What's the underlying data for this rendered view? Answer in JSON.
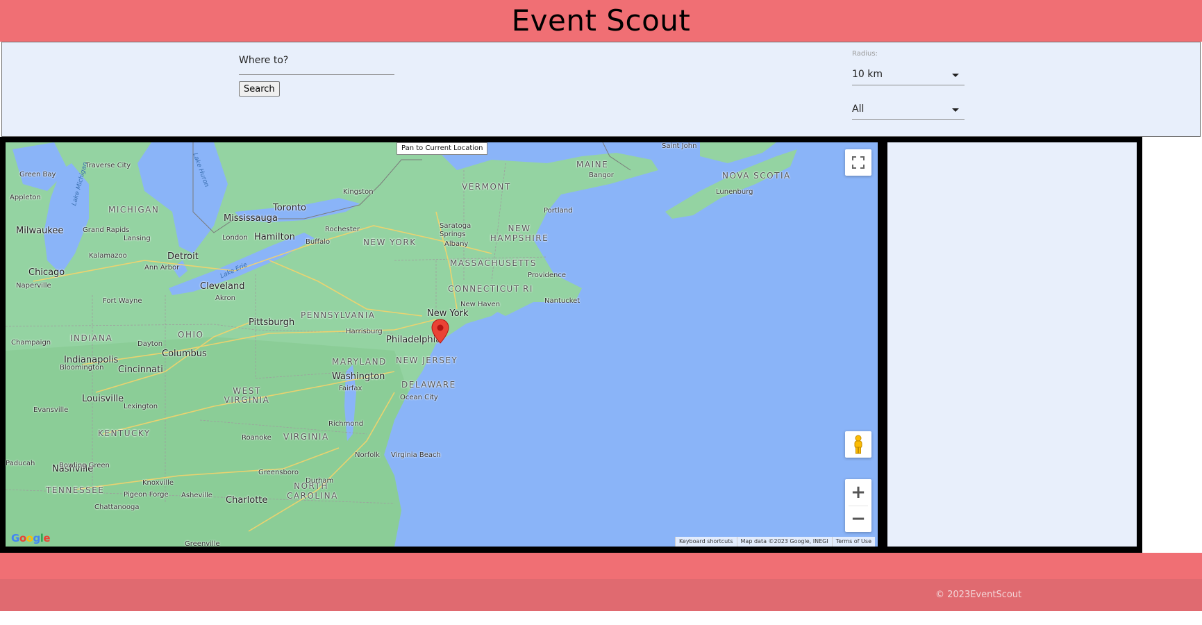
{
  "header": {
    "title": "Event Scout"
  },
  "search": {
    "where_label": "Where to?",
    "search_button": "Search",
    "radius_caption": "Radius:",
    "radius_value": "10 km",
    "category_value": "All"
  },
  "map": {
    "pan_button": "Pan to Current Location",
    "attribution": {
      "shortcuts": "Keyboard shortcuts",
      "data": "Map data ©2023 Google, INEGI",
      "terms": "Terms of Use"
    },
    "google_logo": "Google",
    "states": [
      "MICHIGAN",
      "VERMONT",
      "MAINE",
      "NOVA SCOTIA",
      "NEW HAMPSHIRE",
      "NEW YORK",
      "MASSACHUSETTS",
      "CONNECTICUT",
      "RI",
      "PENNSYLVANIA",
      "INDIANA",
      "OHIO",
      "NEW JERSEY",
      "MARYLAND",
      "DELAWARE",
      "WEST VIRGINIA",
      "VIRGINIA",
      "KENTUCKY",
      "TENNESSEE",
      "NORTH CAROLINA"
    ],
    "cities_major": [
      "Toronto",
      "Mississauga",
      "Hamilton",
      "Detroit",
      "Cleveland",
      "Chicago",
      "Milwaukee",
      "Pittsburgh",
      "Philadelphia",
      "New York",
      "Columbus",
      "Cincinnati",
      "Indianapolis",
      "Louisville",
      "Washington",
      "Nashville",
      "Charlotte"
    ],
    "cities_minor": [
      "Green Bay",
      "Traverse City",
      "Appleton",
      "Grand Rapids",
      "Lansing",
      "Kalamazoo",
      "Ann Arbor",
      "Naperville",
      "Fort Wayne",
      "Champaign",
      "Dayton",
      "Bloomington",
      "Evansville",
      "Lexington",
      "Paducah",
      "Bowling Green",
      "Knoxville",
      "Pigeon Forge",
      "Asheville",
      "Chattanooga",
      "Greenville",
      "Kingston",
      "Rochester",
      "Buffalo",
      "London",
      "Akron",
      "Harrisburg",
      "Albany",
      "Saratoga Springs",
      "Portland",
      "Bangor",
      "Saint John",
      "Lunenburg",
      "Providence",
      "New Haven",
      "Nantucket",
      "Ocean City",
      "Fairfax",
      "Richmond",
      "Roanoke",
      "Norfolk",
      "Virginia Beach",
      "Greensboro",
      "Durham"
    ],
    "water": [
      "Lake Michigan",
      "Lake Huron",
      "Lake Erie"
    ]
  },
  "footer": {
    "copyright": "© 2023EventScout"
  },
  "colors": {
    "header": "#f06f74",
    "panel": "#e8effb",
    "footer": "#e06a70",
    "water": "#8ab4f8",
    "land": "#94d3a2",
    "pin": "#ea4335"
  }
}
